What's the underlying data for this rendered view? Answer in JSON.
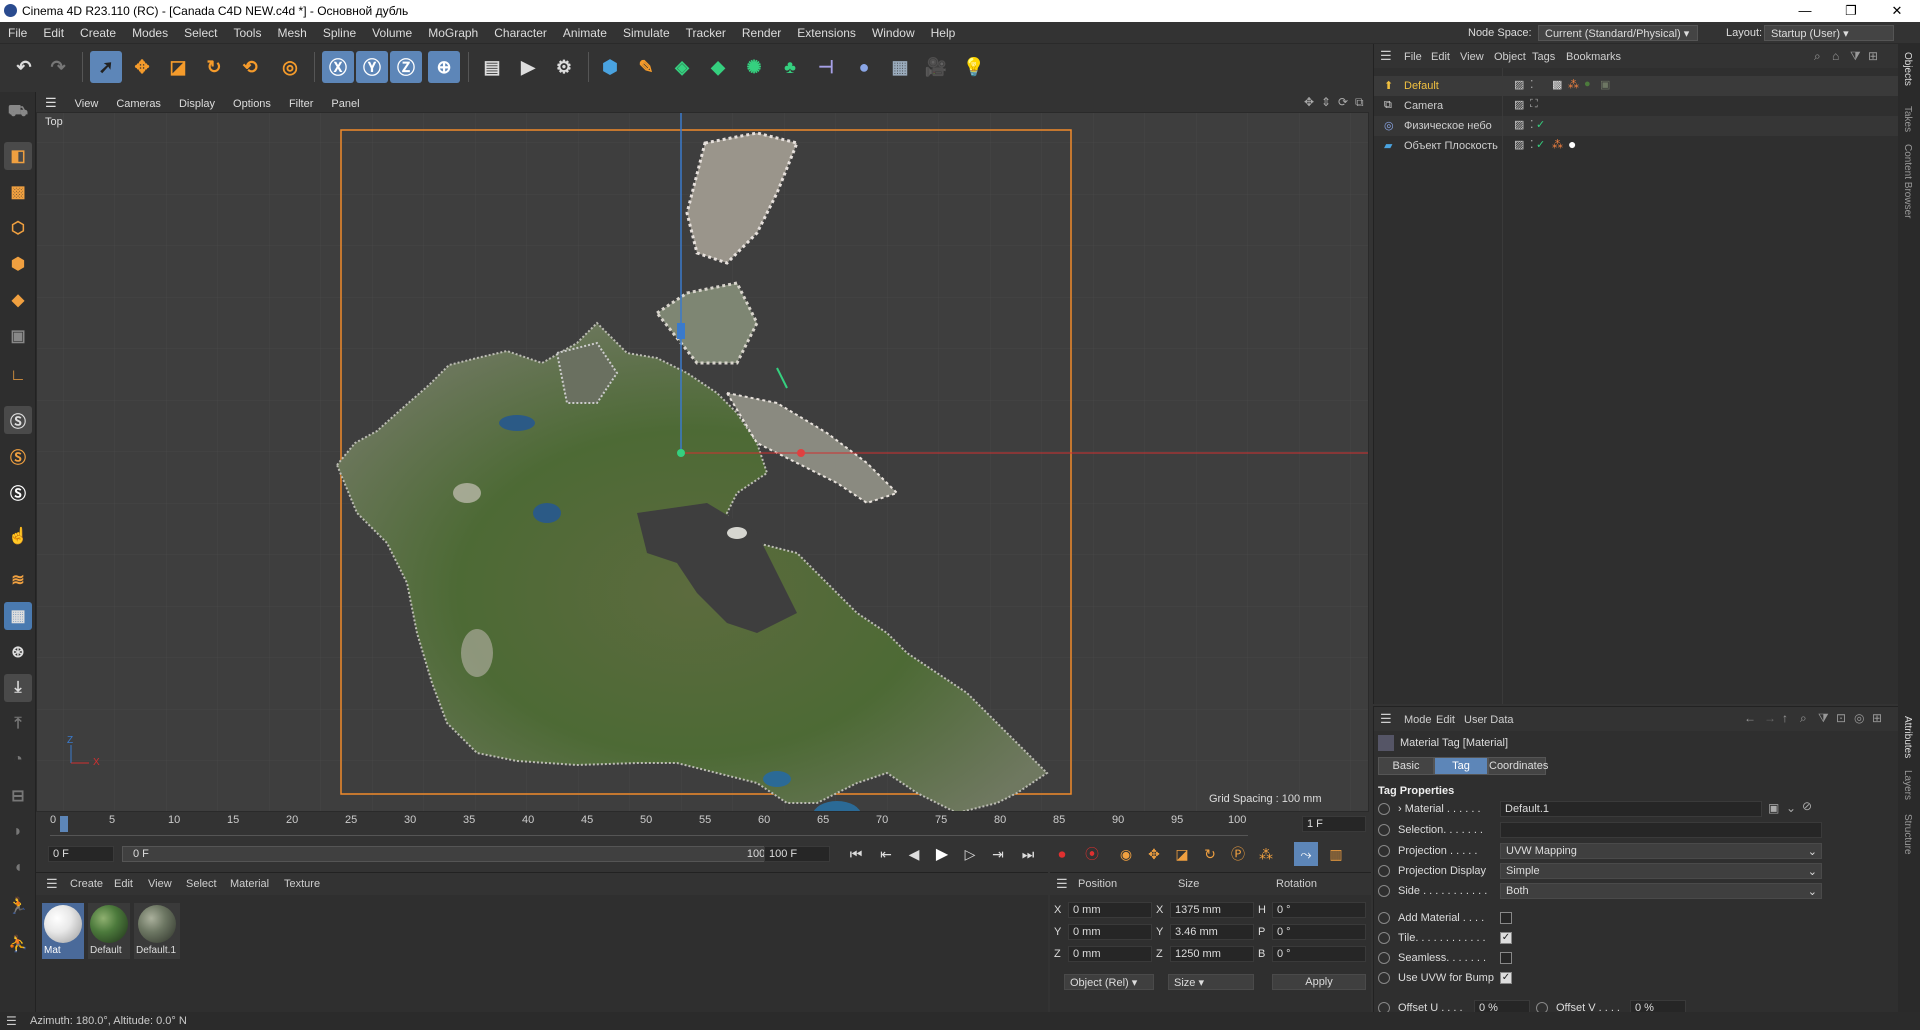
{
  "window": {
    "title": "Cinema 4D R23.110 (RC) - [Canada C4D NEW.c4d *] - Основной дубль"
  },
  "menu": [
    "File",
    "Edit",
    "Create",
    "Modes",
    "Select",
    "Tools",
    "Mesh",
    "Spline",
    "Volume",
    "MoGraph",
    "Character",
    "Animate",
    "Simulate",
    "Tracker",
    "Render",
    "Extensions",
    "Window",
    "Help"
  ],
  "nodespace": {
    "label": "Node Space:",
    "value": "Current (Standard/Physical)"
  },
  "layout": {
    "label": "Layout:",
    "value": "Startup (User)"
  },
  "viewport": {
    "menu": [
      "View",
      "Cameras",
      "Display",
      "Options",
      "Filter",
      "Panel"
    ],
    "view_name": "Top",
    "grid_spacing": "Grid Spacing : 100 mm",
    "axis_z": "Z",
    "axis_x": "X"
  },
  "timeline": {
    "ticks": [
      "0",
      "5",
      "10",
      "15",
      "20",
      "25",
      "30",
      "35",
      "40",
      "45",
      "50",
      "55",
      "60",
      "65",
      "70",
      "75",
      "80",
      "85",
      "90",
      "95",
      "100"
    ],
    "current_frame_field": "1 F",
    "start": "0 F",
    "range_start": "0 F",
    "range_end": "100 F",
    "end": "100 F"
  },
  "material_manager": {
    "menu": [
      "Create",
      "Edit",
      "View",
      "Select",
      "Material",
      "Texture"
    ],
    "materials": [
      {
        "name": "Mat",
        "color": "#e8e8e8"
      },
      {
        "name": "Default",
        "color": "#4c7a3c"
      },
      {
        "name": "Default.1",
        "color": "#6d7763"
      }
    ]
  },
  "coordinates": {
    "headers": [
      "Position",
      "Size",
      "Rotation"
    ],
    "rows": [
      {
        "axis": "X",
        "pos": "0 mm",
        "size_axis": "X",
        "size": "1375 mm",
        "rot_axis": "H",
        "rot": "0 °"
      },
      {
        "axis": "Y",
        "pos": "0 mm",
        "size_axis": "Y",
        "size": "3.46 mm",
        "rot_axis": "P",
        "rot": "0 °"
      },
      {
        "axis": "Z",
        "pos": "0 mm",
        "size_axis": "Z",
        "size": "1250 mm",
        "rot_axis": "B",
        "rot": "0 °"
      }
    ],
    "mode": "Object (Rel)",
    "size_mode": "Size",
    "apply": "Apply"
  },
  "object_manager": {
    "menu": [
      "File",
      "Edit",
      "View",
      "Object",
      "Tags",
      "Bookmarks"
    ],
    "objects": [
      {
        "name": "Default",
        "color": "#f0c040"
      },
      {
        "name": "Camera",
        "color": "#dddddd"
      },
      {
        "name": "Физическое небо",
        "color": "#dddddd"
      },
      {
        "name": "Объект Плоскость",
        "color": "#dddddd"
      }
    ]
  },
  "right_tabs": [
    "Objects",
    "Takes",
    "Content Browser",
    "Attributes",
    "Layers",
    "Structure"
  ],
  "attributes": {
    "menu": [
      "Mode",
      "Edit",
      "User Data"
    ],
    "title": "Material Tag [Material]",
    "tabs": [
      "Basic",
      "Tag",
      "Coordinates"
    ],
    "active_tab": "Tag",
    "section": "Tag Properties",
    "material_label": "Material . . . . . .",
    "material_value": "Default.1",
    "selection_label": "Selection. . . . . . .",
    "projection_label": "Projection . . . . .",
    "projection_value": "UVW Mapping",
    "projection_display_label": "Projection Display",
    "projection_display_value": "Simple",
    "side_label": "Side . . . . . . . . . . .",
    "side_value": "Both",
    "add_material_label": "Add Material . . . .",
    "tile_label": "Tile. . . . . . . . . . . .",
    "seamless_label": "Seamless. . . . . . .",
    "use_uvw_label": "Use UVW for Bump",
    "offset_u_label": "Offset U . . . .",
    "offset_u_value": "0 %",
    "offset_v_label": "Offset V . . . .",
    "offset_v_value": "0 %",
    "checkboxes": {
      "add_material": false,
      "tile": true,
      "seamless": false,
      "use_uvw": true
    }
  },
  "status": {
    "text": "Azimuth: 180.0°, Altitude: 0.0°  N"
  }
}
